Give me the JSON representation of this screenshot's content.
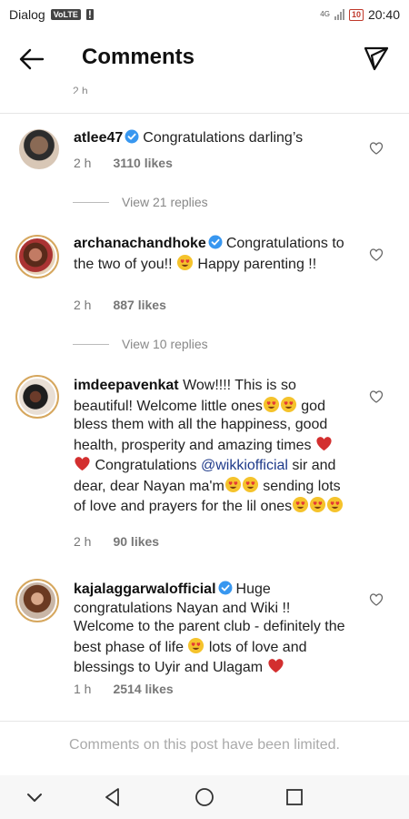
{
  "status_bar": {
    "carrier": "Dialog",
    "volte": "VoLTE",
    "network": "4G",
    "battery": "10",
    "time": "20:40"
  },
  "header": {
    "title": "Comments"
  },
  "previous_comment_time": "2 h",
  "comments": [
    {
      "username": "atlee47",
      "text": "Congratulations  darling’s",
      "time": "2 h",
      "likes": "3110 likes",
      "replies": "View 21 replies"
    },
    {
      "username": "archanachandhoke",
      "text_a": "Congratulations to the two of you!!",
      "text_b": "Happy parenting !!",
      "time": "2 h",
      "likes": "887 likes",
      "replies": "View 10 replies"
    },
    {
      "username": "imdeepavenkat",
      "text_a": "Wow!!!! This is so beautiful! Welcome little ones",
      "text_b": "god bless them with all the happiness, good health, prosperity and amazing times",
      "text_c": "Congratulations",
      "mention": "@wikkiofficial",
      "text_d": "sir and dear, dear Nayan ma'm",
      "text_e": "sending lots of love and prayers for the lil ones",
      "time": "2 h",
      "likes": "90 likes"
    },
    {
      "username": "kajalaggarwalofficial",
      "text_a": "Huge congratulations Nayan and Wiki !! Welcome to the parent club - definitely the best phase of life",
      "text_b": "lots of love and blessings to Uyir and Ulagam",
      "time": "1 h",
      "likes": "2514 likes"
    }
  ],
  "footer": {
    "limited_text": "Comments on this post have been limited."
  },
  "icons": {
    "back": "back-arrow-icon",
    "send": "send-icon",
    "heart": "heart-outline-icon",
    "verified": "verified-badge-icon"
  },
  "colors": {
    "verified": "#3897f0",
    "mention": "#1e3a8a",
    "red_heart": "#d32f2f"
  }
}
